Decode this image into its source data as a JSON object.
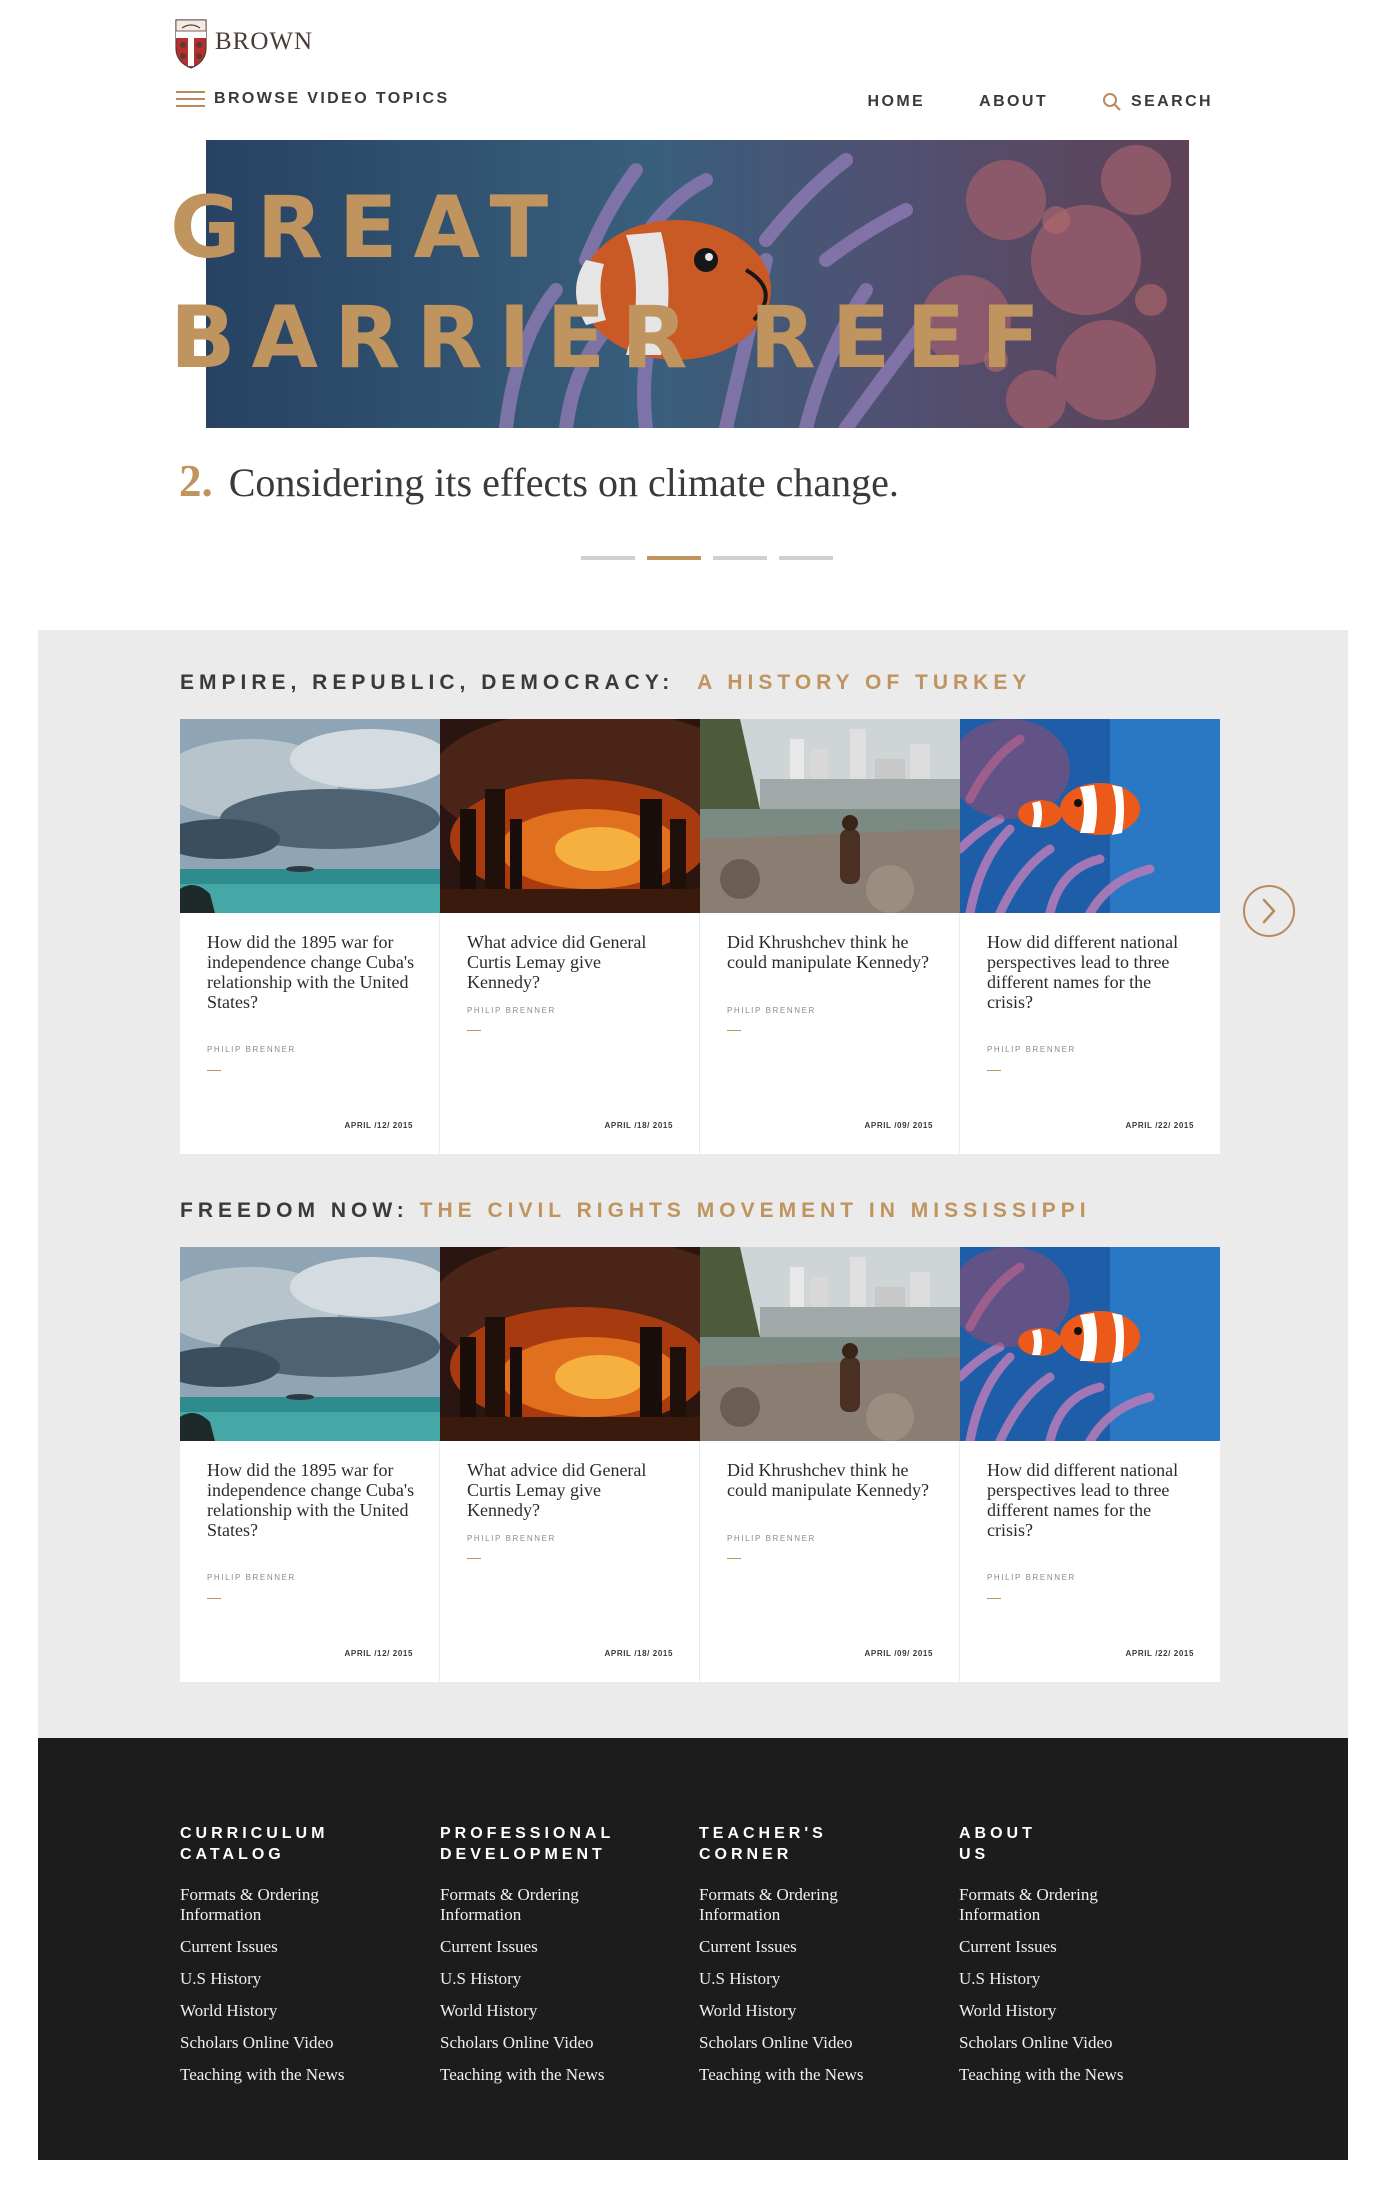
{
  "brand": {
    "name": "BROWN",
    "gold": "#c0945f",
    "dark_footer": "#1c1c1c",
    "grey_bg": "#ebebeb"
  },
  "header": {
    "browse_label": "BROWSE VIDEO TOPICS",
    "nav": {
      "home": "HOME",
      "about": "ABOUT",
      "search": "SEARCH"
    }
  },
  "hero": {
    "title_line1": "GREAT",
    "title_line2": "BARRIER REEF",
    "caption_number": "2.",
    "caption_text": "Considering its effects on climate change.",
    "slides_total": 4,
    "active_slide": 2
  },
  "sections": [
    {
      "title_dark": "EMPIRE, REPUBLIC, DEMOCRACY:",
      "title_gold": "A HISTORY OF TURKEY",
      "cards": [
        {
          "image": "storm-sea",
          "title": "How did the 1895 war for independence change Cuba's relationship with the United States?",
          "author": "PHILIP BRENNER",
          "date": "APRIL /12/ 2015"
        },
        {
          "image": "fire-factory",
          "title": "What advice did General Curtis Lemay give Kennedy?",
          "author": "PHILIP BRENNER",
          "date": "APRIL /18/ 2015"
        },
        {
          "image": "slum-city",
          "title": "Did Khrushchev think he could manipulate Kennedy?",
          "author": "PHILIP BRENNER",
          "date": "APRIL /09/ 2015"
        },
        {
          "image": "clownfish",
          "title": "How did different national perspectives lead to three different names for the crisis?",
          "author": "PHILIP BRENNER",
          "date": "APRIL /22/ 2015"
        }
      ]
    },
    {
      "title_dark": "FREEDOM NOW:",
      "title_gold": "THE CIVIL RIGHTS MOVEMENT IN MISSISSIPPI",
      "cards": [
        {
          "image": "storm-sea",
          "title": "How did the 1895 war for independence change Cuba's relationship with the United States?",
          "author": "PHILIP BRENNER",
          "date": "APRIL /12/ 2015"
        },
        {
          "image": "fire-factory",
          "title": "What advice did General Curtis Lemay give Kennedy?",
          "author": "PHILIP BRENNER",
          "date": "APRIL /18/ 2015"
        },
        {
          "image": "slum-city",
          "title": "Did Khrushchev think he could manipulate Kennedy?",
          "author": "PHILIP BRENNER",
          "date": "APRIL /09/ 2015"
        },
        {
          "image": "clownfish",
          "title": "How did different national perspectives lead to three different names for the crisis?",
          "author": "PHILIP BRENNER",
          "date": "APRIL /22/ 2015"
        }
      ]
    }
  ],
  "footer": {
    "columns": [
      {
        "title": "CURRICULUM\nCATALOG",
        "links": [
          "Formats & Ordering Information",
          "Current Issues",
          "U.S History",
          "World History",
          "Scholars Online Video",
          "Teaching with the News"
        ]
      },
      {
        "title": "PROFESSIONAL\nDEVELOPMENT",
        "links": [
          "Formats & Ordering Information",
          "Current Issues",
          "U.S History",
          "World History",
          "Scholars Online Video",
          "Teaching with the News"
        ]
      },
      {
        "title": "TEACHER'S\nCORNER",
        "links": [
          "Formats & Ordering Information",
          "Current Issues",
          "U.S History",
          "World History",
          "Scholars Online Video",
          "Teaching with the News"
        ]
      },
      {
        "title": "ABOUT\nUS",
        "links": [
          "Formats & Ordering Information",
          "Current Issues",
          "U.S History",
          "World History",
          "Scholars Online Video",
          "Teaching with the News"
        ]
      }
    ]
  }
}
